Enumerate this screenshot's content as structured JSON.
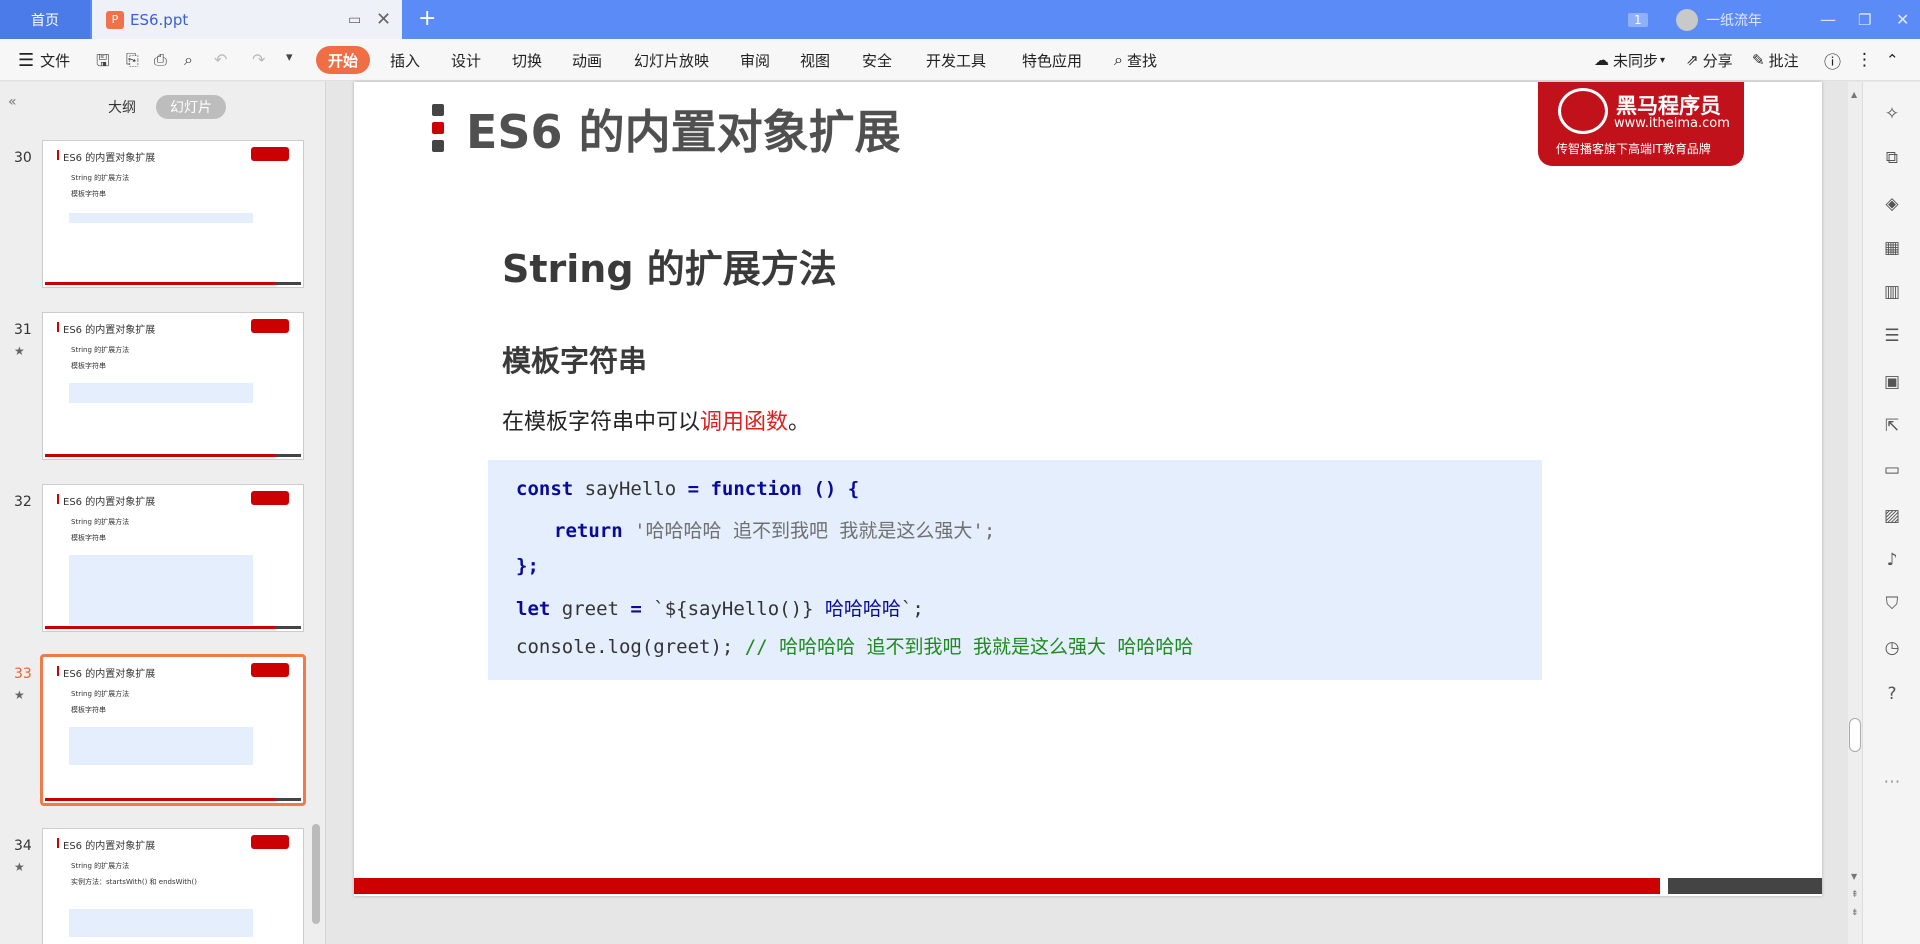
{
  "titlebar": {
    "home_tab": "首页",
    "file_tab": "ES6.ppt",
    "page_badge": "1",
    "user_name": "一纸流年"
  },
  "menubar": {
    "file_label": "文件",
    "items": [
      "开始",
      "插入",
      "设计",
      "切换",
      "动画",
      "幻灯片放映",
      "审阅",
      "视图",
      "安全",
      "开发工具",
      "特色应用"
    ],
    "search_label": "查找",
    "sync_label": "未同步",
    "share_label": "分享",
    "annotate_label": "批注"
  },
  "left_panel": {
    "outline_label": "大纲",
    "slides_label": "幻灯片",
    "thumbnails": [
      {
        "num": "30",
        "title": "ES6 的内置对象扩展",
        "sub": "String 的扩展方法",
        "sub2": "模板字符串",
        "starred": false,
        "selected": false
      },
      {
        "num": "31",
        "title": "ES6 的内置对象扩展",
        "sub": "String 的扩展方法",
        "sub2": "模板字符串",
        "starred": true,
        "selected": false
      },
      {
        "num": "32",
        "title": "ES6 的内置对象扩展",
        "sub": "String 的扩展方法",
        "sub2": "模板字符串",
        "starred": false,
        "selected": false
      },
      {
        "num": "33",
        "title": "ES6 的内置对象扩展",
        "sub": "String 的扩展方法",
        "sub2": "模板字符串",
        "starred": true,
        "selected": true
      },
      {
        "num": "34",
        "title": "ES6 的内置对象扩展",
        "sub": "String 的扩展方法",
        "sub2": "实例方法：startsWith() 和 endsWith()",
        "starred": true,
        "selected": false
      }
    ]
  },
  "slide": {
    "title": "ES6 的内置对象扩展",
    "logo_name": "黑马程序员",
    "logo_url": "www.itheima.com",
    "logo_slogan": "传智播客旗下高端IT教育品牌",
    "heading": "String 的扩展方法",
    "subheading": "模板字符串",
    "para_prefix": "在模板字符串中可以",
    "para_highlight": "调用函数",
    "para_suffix": "。",
    "code": {
      "l1_kw1": "const",
      "l1_mid": " sayHello ",
      "l1_kw2": "=",
      "l1_kw3": " function",
      "l1_end": " () {",
      "l2_kw": "return",
      "l2_str": " '哈哈哈哈 追不到我吧 我就是这么强大';",
      "l3": "};",
      "l4_kw": "let",
      "l4_mid": " greet ",
      "l4_eq": "=",
      "l4_tpl": " `${sayHello()}",
      "l4_txt": " 哈哈哈哈",
      "l4_end": "`;",
      "l5_code": "console.log",
      "l5_args": "(greet);",
      "l5_comment": " // 哈哈哈哈 追不到我吧 我就是这么强大 哈哈哈哈"
    }
  },
  "colors": {
    "titlebar": "#5b8bf7",
    "accent": "#ef6e46",
    "brand_red": "#c00000",
    "code_bg": "#e4eefc"
  }
}
